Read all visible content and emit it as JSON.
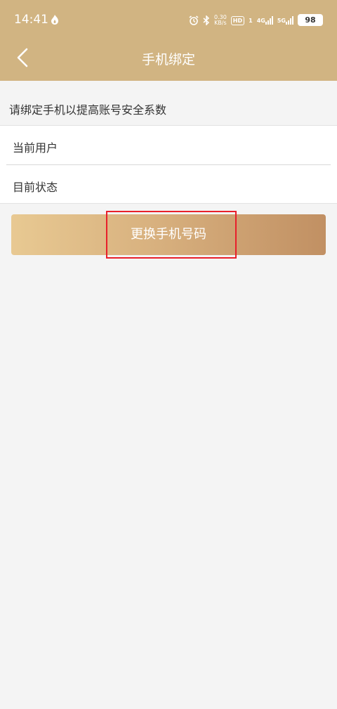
{
  "status_bar": {
    "time": "14:41",
    "speed_top": "0.30",
    "speed_bottom": "KB/s",
    "hd_label": "HD",
    "sim1": "1",
    "net1": "4G",
    "net2": "5G",
    "battery": "98"
  },
  "header": {
    "title": "手机绑定",
    "back_icon": "chevron-left-icon",
    "background_color": "#d1b482"
  },
  "main": {
    "hint": "请绑定手机以提高账号安全系数",
    "rows": [
      {
        "label": "当前用户",
        "value": ""
      },
      {
        "label": "目前状态",
        "value": ""
      }
    ],
    "change_button_label": "更换手机号码"
  },
  "colors": {
    "button_gradient_start": "#e8c992",
    "button_gradient_end": "#c19063",
    "highlight": "#e8202a",
    "page_background": "#f4f4f4"
  }
}
